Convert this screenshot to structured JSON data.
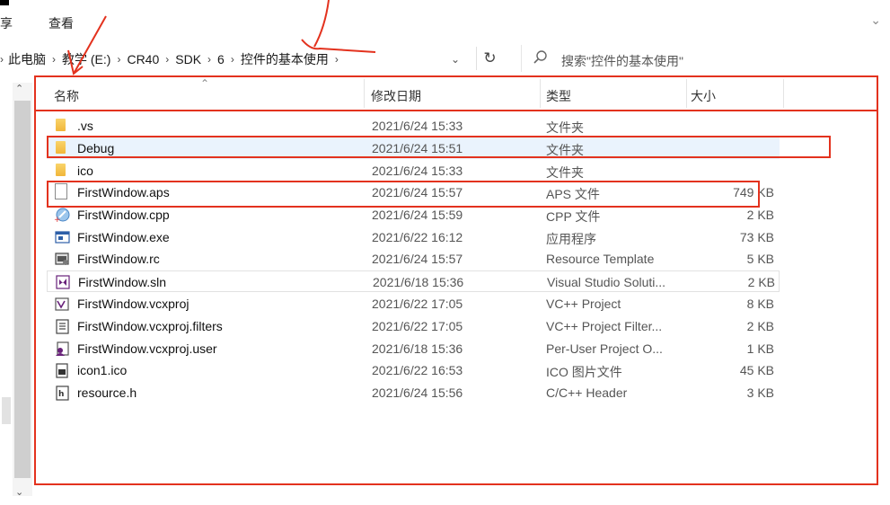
{
  "ribbon": {
    "tabs": [
      {
        "label": "享"
      },
      {
        "label": "查看"
      }
    ],
    "expand_icon": "chevron-down-icon"
  },
  "address": {
    "crumbs": [
      "此电脑",
      "教学 (E:)",
      "CR40",
      "SDK",
      "6",
      "控件的基本使用"
    ],
    "refresh_icon": "refresh-icon"
  },
  "search": {
    "placeholder": "搜索\"控件的基本使用\""
  },
  "columns": {
    "name": "名称",
    "date": "修改日期",
    "type": "类型",
    "size": "大小"
  },
  "files": [
    {
      "name": ".vs",
      "date": "2021/6/24 15:33",
      "type": "文件夹",
      "size": "",
      "icon": "folder-icon"
    },
    {
      "name": "Debug",
      "date": "2021/6/24 15:51",
      "type": "文件夹",
      "size": "",
      "icon": "folder-icon"
    },
    {
      "name": "ico",
      "date": "2021/6/24 15:33",
      "type": "文件夹",
      "size": "",
      "icon": "folder-icon"
    },
    {
      "name": "FirstWindow.aps",
      "date": "2021/6/24 15:57",
      "type": "APS 文件",
      "size": "749 KB",
      "icon": "file-icon"
    },
    {
      "name": "FirstWindow.cpp",
      "date": "2021/6/24 15:59",
      "type": "CPP 文件",
      "size": "2 KB",
      "icon": "cpp-file-icon"
    },
    {
      "name": "FirstWindow.exe",
      "date": "2021/6/22 16:12",
      "type": "应用程序",
      "size": "73 KB",
      "icon": "exe-icon"
    },
    {
      "name": "FirstWindow.rc",
      "date": "2021/6/24 15:57",
      "type": "Resource Template",
      "size": "5 KB",
      "icon": "rc-file-icon"
    },
    {
      "name": "FirstWindow.sln",
      "date": "2021/6/18 15:36",
      "type": "Visual Studio Soluti...",
      "size": "2 KB",
      "icon": "sln-file-icon"
    },
    {
      "name": "FirstWindow.vcxproj",
      "date": "2021/6/22 17:05",
      "type": "VC++ Project",
      "size": "8 KB",
      "icon": "vcxproj-file-icon"
    },
    {
      "name": "FirstWindow.vcxproj.filters",
      "date": "2021/6/22 17:05",
      "type": "VC++ Project Filter...",
      "size": "2 KB",
      "icon": "filters-file-icon"
    },
    {
      "name": "FirstWindow.vcxproj.user",
      "date": "2021/6/18 15:36",
      "type": "Per-User Project O...",
      "size": "1 KB",
      "icon": "user-file-icon"
    },
    {
      "name": "icon1.ico",
      "date": "2021/6/22 16:53",
      "type": "ICO 图片文件",
      "size": "45 KB",
      "icon": "ico-file-icon"
    },
    {
      "name": "resource.h",
      "date": "2021/6/24 15:56",
      "type": "C/C++ Header",
      "size": "3 KB",
      "icon": "header-file-icon"
    }
  ],
  "colors": {
    "annotation_red": "#e3321e",
    "selection": "#eaf3fd",
    "folder": "#f1b63a"
  }
}
